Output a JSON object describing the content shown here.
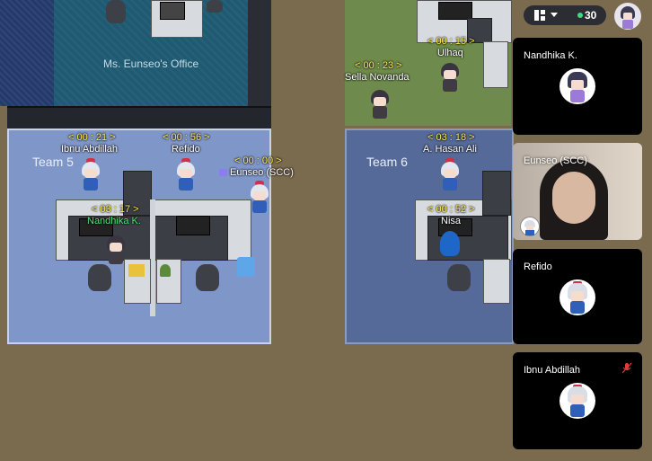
{
  "map": {
    "office_label": "Ms. Eunseo's Office",
    "team5_label": "Team 5",
    "team6_label": "Team 6"
  },
  "players": [
    {
      "timer": "< 00 : 23 >",
      "name": "Sella Novanda"
    },
    {
      "timer": "< 00 : 15 >",
      "name": "Ulhaq"
    },
    {
      "timer": "< 00 : 21 >",
      "name": "Ibnu Abdillah"
    },
    {
      "timer": "< 00 : 56 >",
      "name": "Refido"
    },
    {
      "timer": "< 00 : 00 >",
      "name": "Eunseo (SCC)"
    },
    {
      "timer": "< 03 : 17 >",
      "name": "Nandhika K."
    },
    {
      "timer": "< 03 : 18 >",
      "name": "A. Hasan Ali"
    },
    {
      "timer": "< 00 : 52 >",
      "name": "Nisa"
    }
  ],
  "topbar": {
    "layout_icon": "grid-layout-icon",
    "chevron_icon": "chevron-down-icon",
    "online_count": "30",
    "status_color": "#3ddc84"
  },
  "video_tiles": [
    {
      "name": "Nandhika K."
    },
    {
      "name": "Eunseo (SCC)"
    },
    {
      "name": "Refido"
    },
    {
      "name": "Ibnu Abdillah",
      "muted_icon": "mic-off-icon"
    }
  ]
}
